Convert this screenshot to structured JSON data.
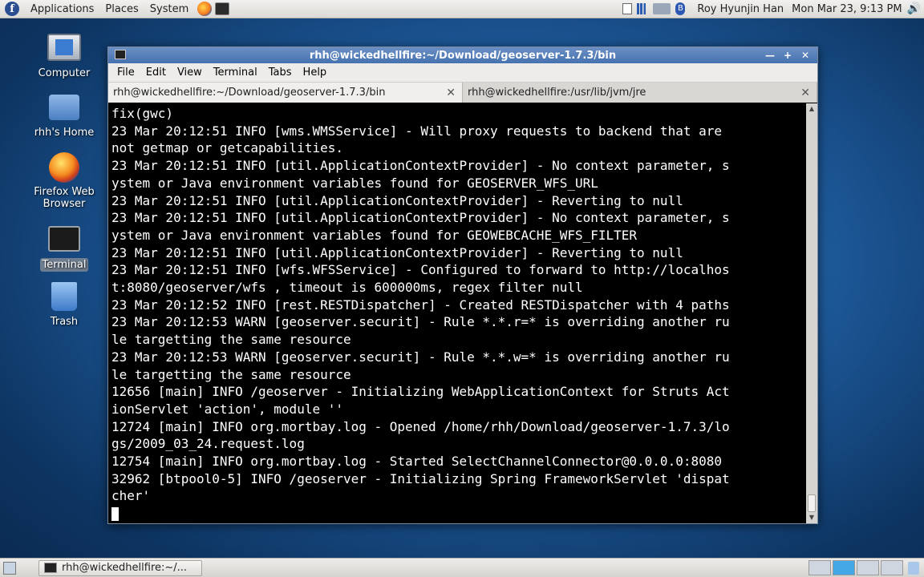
{
  "top_panel": {
    "menus": [
      "Applications",
      "Places",
      "System"
    ],
    "user": "Roy Hyunjin Han",
    "clock": "Mon Mar 23,  9:13 PM"
  },
  "desktop_icons": [
    {
      "label": "Computer"
    },
    {
      "label": "rhh's Home"
    },
    {
      "label": "Firefox Web Browser"
    },
    {
      "label": "Terminal"
    },
    {
      "label": "Trash"
    }
  ],
  "window": {
    "title": "rhh@wickedhellfire:~/Download/geoserver-1.7.3/bin",
    "menus": [
      "File",
      "Edit",
      "View",
      "Terminal",
      "Tabs",
      "Help"
    ],
    "tabs": [
      {
        "label": "rhh@wickedhellfire:~/Download/geoserver-1.7.3/bin",
        "active": true
      },
      {
        "label": "rhh@wickedhellfire:/usr/lib/jvm/jre",
        "active": false
      }
    ],
    "terminal_lines": [
      "fix(gwc)",
      "23 Mar 20:12:51 INFO [wms.WMSService] - Will proxy requests to backend that are",
      "not getmap or getcapabilities.",
      "23 Mar 20:12:51 INFO [util.ApplicationContextProvider] - No context parameter, s",
      "ystem or Java environment variables found for GEOSERVER_WFS_URL",
      "23 Mar 20:12:51 INFO [util.ApplicationContextProvider] - Reverting to null",
      "23 Mar 20:12:51 INFO [util.ApplicationContextProvider] - No context parameter, s",
      "ystem or Java environment variables found for GEOWEBCACHE_WFS_FILTER",
      "23 Mar 20:12:51 INFO [util.ApplicationContextProvider] - Reverting to null",
      "23 Mar 20:12:51 INFO [wfs.WFSService] - Configured to forward to http://localhos",
      "t:8080/geoserver/wfs , timeout is 600000ms, regex filter null",
      "23 Mar 20:12:52 INFO [rest.RESTDispatcher] - Created RESTDispatcher with 4 paths",
      "23 Mar 20:12:53 WARN [geoserver.securit] - Rule *.*.r=* is overriding another ru",
      "le targetting the same resource",
      "23 Mar 20:12:53 WARN [geoserver.securit] - Rule *.*.w=* is overriding another ru",
      "le targetting the same resource",
      "12656 [main] INFO /geoserver - Initializing WebApplicationContext for Struts Act",
      "ionServlet 'action', module ''",
      "12724 [main] INFO org.mortbay.log - Opened /home/rhh/Download/geoserver-1.7.3/lo",
      "gs/2009_03_24.request.log",
      "12754 [main] INFO org.mortbay.log - Started SelectChannelConnector@0.0.0.0:8080",
      "32962 [btpool0-5] INFO /geoserver - Initializing Spring FrameworkServlet 'dispat",
      "cher'"
    ]
  },
  "bottom_panel": {
    "task_label": "rhh@wickedhellfire:~/..."
  }
}
